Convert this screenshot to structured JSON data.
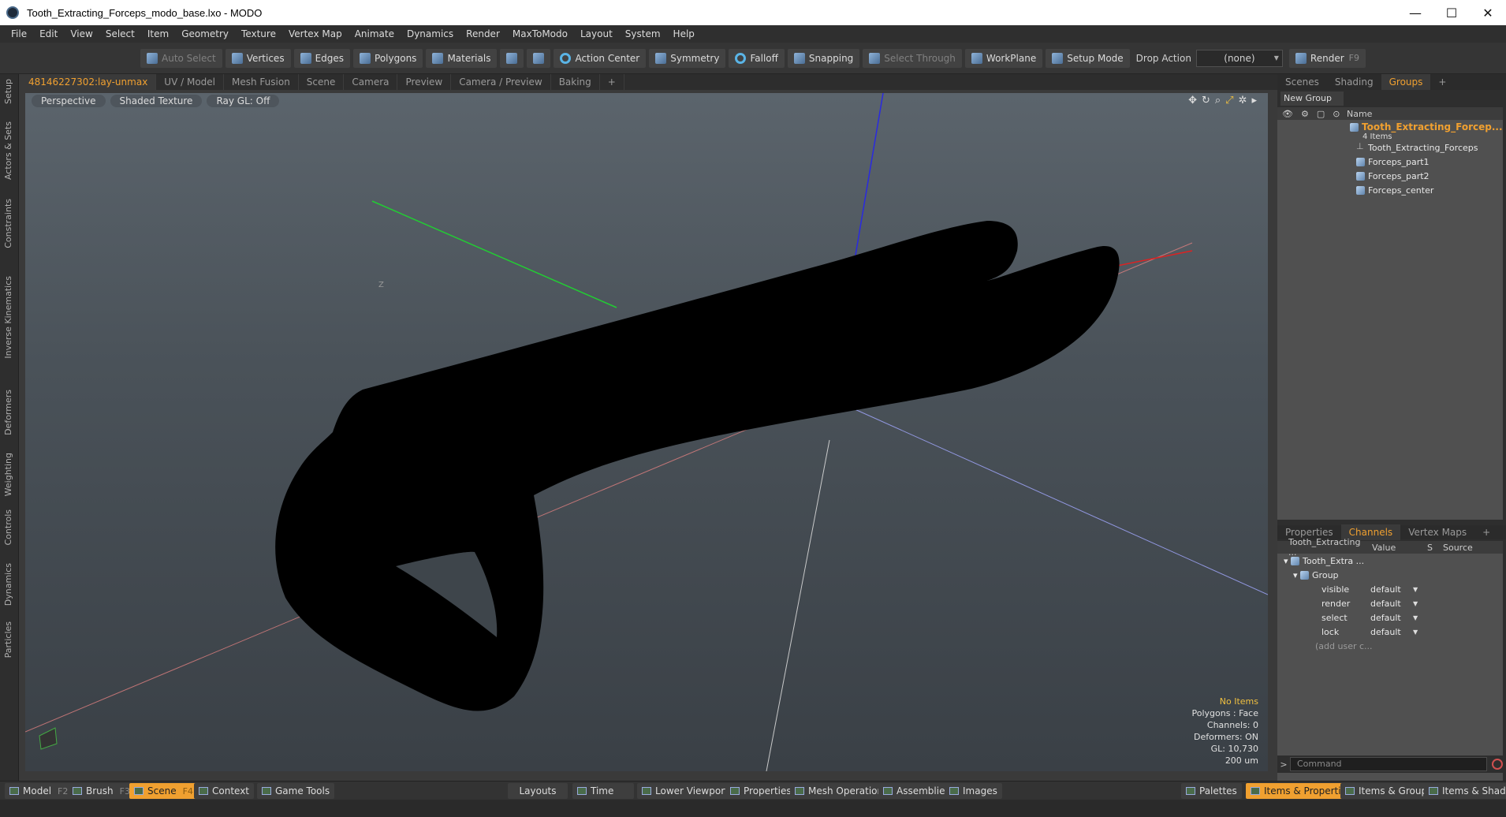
{
  "window": {
    "title": "Tooth_Extracting_Forceps_modo_base.lxo - MODO",
    "min": "—",
    "max": "☐",
    "close": "✕"
  },
  "menu": [
    "File",
    "Edit",
    "View",
    "Select",
    "Item",
    "Geometry",
    "Texture",
    "Vertex Map",
    "Animate",
    "Dynamics",
    "Render",
    "MaxToModo",
    "Layout",
    "System",
    "Help"
  ],
  "toolbar": {
    "auto_select": "Auto Select",
    "vertices": "Vertices",
    "edges": "Edges",
    "polygons": "Polygons",
    "materials": "Materials",
    "action_center": "Action Center",
    "symmetry": "Symmetry",
    "falloff": "Falloff",
    "snapping": "Snapping",
    "select_through": "Select Through",
    "workplane": "WorkPlane",
    "setup_mode": "Setup Mode",
    "drop_action": "Drop Action",
    "drop_value": "(none)",
    "render": "Render",
    "render_key": "F9"
  },
  "left_tabs": [
    "Setup",
    "Actors & Sets",
    "Constraints",
    "Inverse Kinematics",
    "Deformers",
    "Weighting",
    "Controls",
    "Dynamics",
    "Particles"
  ],
  "viewport_tabs": [
    "48146227302:lay-unmax",
    "UV / Model",
    "Mesh Fusion",
    "Scene",
    "Camera",
    "Preview",
    "Camera / Preview",
    "Baking",
    "+"
  ],
  "viewport": {
    "perspective": "Perspective",
    "shading": "Shaded Texture",
    "raygl": "Ray GL: Off",
    "axis_label": "Z",
    "info": {
      "items": "No Items",
      "polygons": "Polygons : Face",
      "channels": "Channels: 0",
      "deformers": "Deformers: ON",
      "gl": "GL: 10,730",
      "scale": "200 um"
    }
  },
  "right_tabs": [
    "Scenes",
    "Shading",
    "Groups",
    "+"
  ],
  "groups": {
    "new_group": "New Group",
    "name_header": "Name",
    "parent": "Tooth_Extracting_Forcep...",
    "count": "4 Items",
    "children": [
      "Tooth_Extracting_Forceps",
      "Forceps_part1",
      "Forceps_part2",
      "Forceps_center"
    ]
  },
  "prop_tabs": [
    "Properties",
    "Channels",
    "Vertex Maps",
    "+"
  ],
  "channels": {
    "headers": {
      "name": "Tooth_Extracting ...",
      "value": "Value",
      "s": "S",
      "source": "Source"
    },
    "item": "Tooth_Extra ...",
    "group": "Group",
    "rows": [
      {
        "label": "visible",
        "value": "default"
      },
      {
        "label": "render",
        "value": "default"
      },
      {
        "label": "select",
        "value": "default"
      },
      {
        "label": "lock",
        "value": "default"
      }
    ],
    "add_user": "(add user c..."
  },
  "command": {
    "prompt": ">",
    "placeholder": "Command"
  },
  "bottom": {
    "model": "Model",
    "model_key": "F2",
    "brush": "Brush",
    "brush_key": "F3",
    "scene": "Scene",
    "scene_key": "F4",
    "context": "Context",
    "game_tools": "Game Tools",
    "layouts": "Layouts",
    "time": "Time",
    "lower_viewports": "Lower Viewports",
    "properties": "Properties",
    "mesh_operations": "Mesh Operations",
    "assemblies": "Assemblies",
    "images": "Images",
    "palettes": "Palettes",
    "items_properties": "Items & Properties",
    "items_groups": "Items & Groups",
    "items_shading": "Items & Shading"
  }
}
